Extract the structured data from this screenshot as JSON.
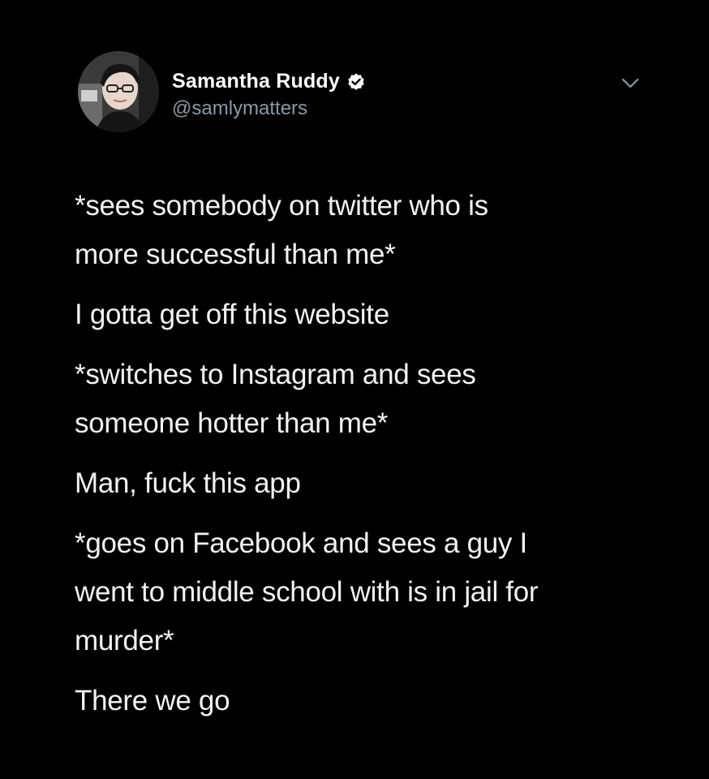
{
  "author": {
    "display_name": "Samantha Ruddy",
    "handle": "@samlymatters",
    "verified": true
  },
  "tweet": {
    "paragraphs": [
      "*sees somebody on twitter who is\nmore successful than me*",
      "I gotta get off this website",
      "*switches to Instagram and sees\nsomeone hotter than me*",
      "Man, fuck this app",
      "*goes on Facebook and sees a guy I\nwent to middle school with is in jail for\nmurder*",
      "There we go"
    ]
  },
  "colors": {
    "background": "#000000",
    "text": "#f2f2f2",
    "handle": "#8b98a5",
    "verified_badge": "#ffffff"
  },
  "icons": {
    "verified": "verified-badge-icon",
    "menu": "chevron-down-icon"
  }
}
